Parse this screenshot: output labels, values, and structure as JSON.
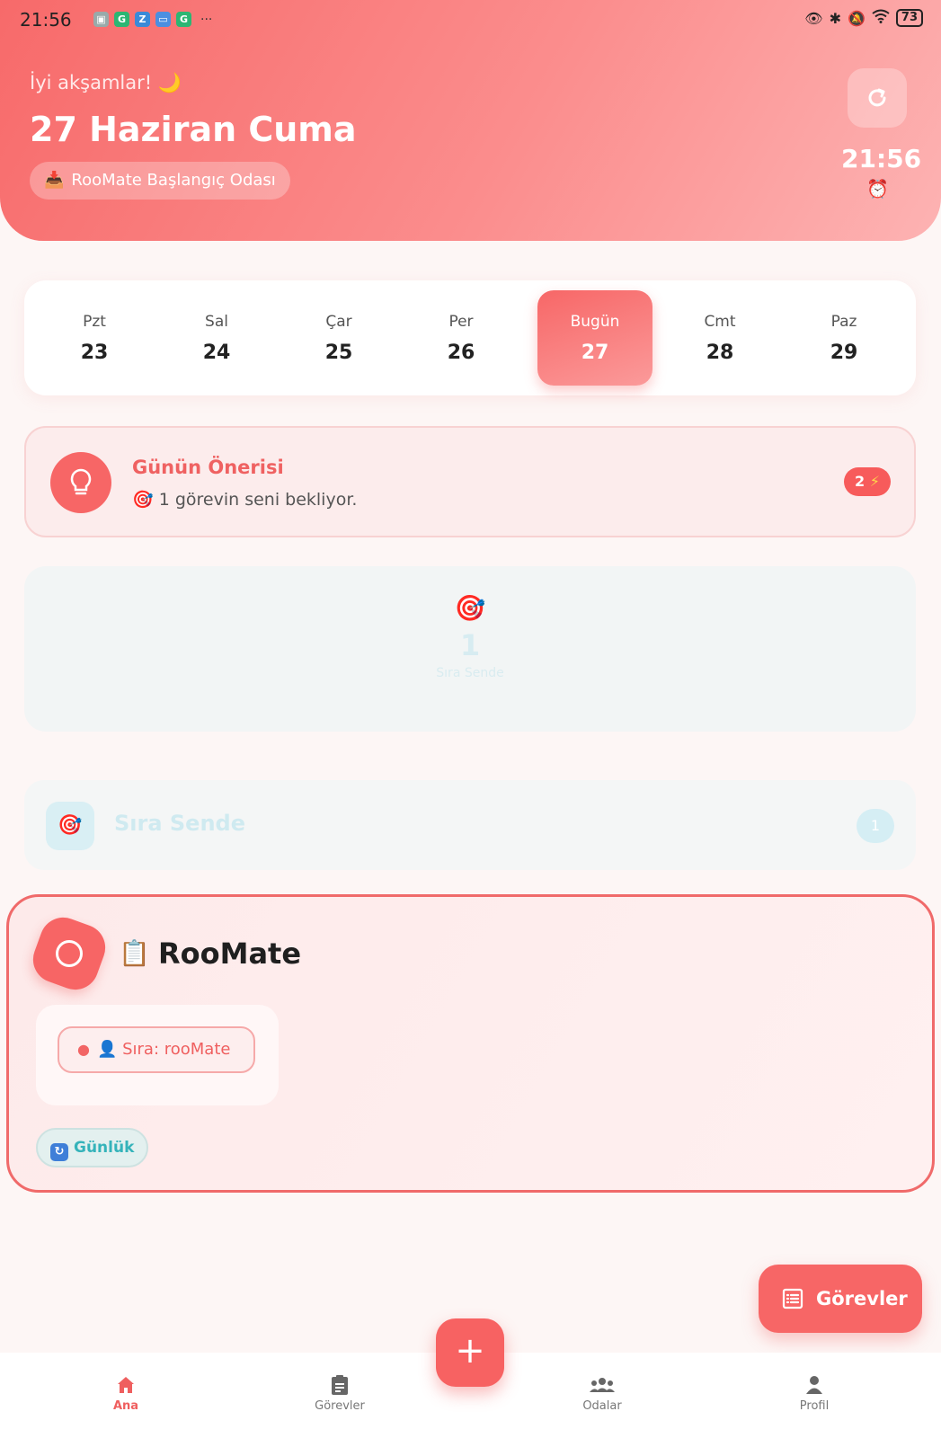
{
  "status_bar": {
    "time": "21:56",
    "more": "···",
    "battery": "73"
  },
  "header": {
    "greeting": "İyi akşamlar! 🌙",
    "date_title": "27 Haziran Cuma",
    "room_name": "RooMate Başlangıç Odası",
    "room_icon": "📥",
    "clock": "21:56",
    "alarm_icon": "⏰"
  },
  "week": [
    {
      "name": "Pzt",
      "num": "23",
      "active": false
    },
    {
      "name": "Sal",
      "num": "24",
      "active": false
    },
    {
      "name": "Çar",
      "num": "25",
      "active": false
    },
    {
      "name": "Per",
      "num": "26",
      "active": false
    },
    {
      "name": "Bugün",
      "num": "27",
      "active": true
    },
    {
      "name": "Cmt",
      "num": "28",
      "active": false
    },
    {
      "name": "Paz",
      "num": "29",
      "active": false
    }
  ],
  "suggestion": {
    "title": "Günün Önerisi",
    "text": "🎯 1 görevin seni bekliyor.",
    "badge_count": "2",
    "badge_icon": "⚡"
  },
  "stat": {
    "icon": "🎯",
    "value": "1",
    "label": "Sıra Sende"
  },
  "section": {
    "icon": "🎯",
    "title": "Sıra Sende",
    "count": "1"
  },
  "task": {
    "clip_icon": "📋",
    "title": "RooMate",
    "assignee_label": "👤 Sıra: rooMate",
    "frequency": "Günlük",
    "frequency_icon": "🔄"
  },
  "fab": {
    "label": "Görevler"
  },
  "plus": "+",
  "nav": {
    "items": [
      {
        "label": "Ana",
        "active": true
      },
      {
        "label": "Görevler",
        "active": false
      },
      {
        "label": "Odalar",
        "active": false
      },
      {
        "label": "Profil",
        "active": false
      }
    ]
  },
  "colors": {
    "accent": "#f76666",
    "teal": "#35b3ba"
  }
}
